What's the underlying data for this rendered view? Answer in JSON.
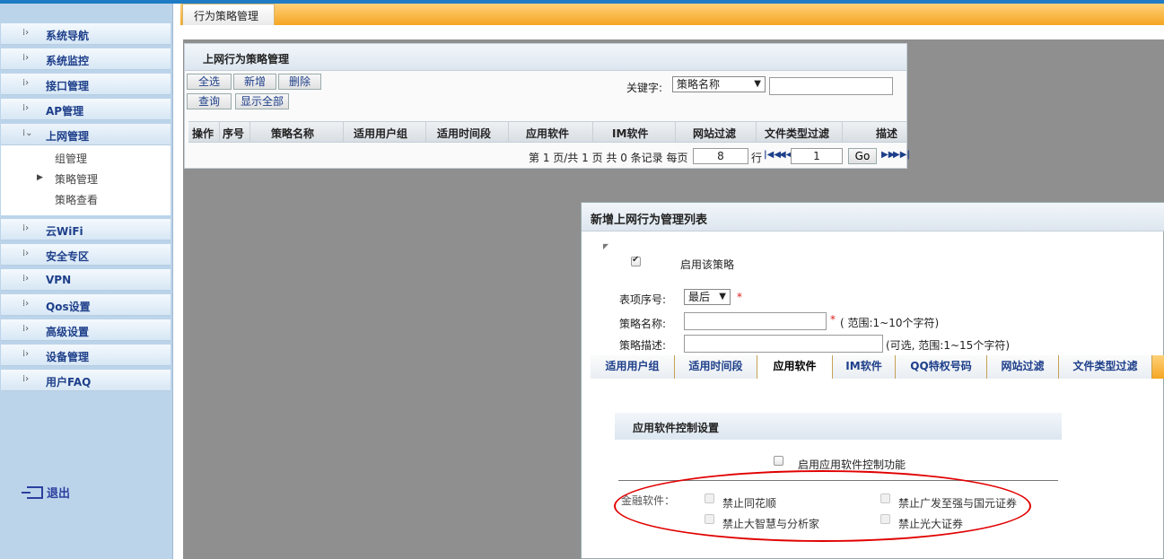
{
  "sidebar": {
    "items": [
      {
        "label": "系统导航"
      },
      {
        "label": "系统监控"
      },
      {
        "label": "接口管理"
      },
      {
        "label": "AP管理"
      },
      {
        "label": "上网管理"
      },
      {
        "label": "云WiFi"
      },
      {
        "label": "安全专区"
      },
      {
        "label": "VPN"
      },
      {
        "label": "Qos设置"
      },
      {
        "label": "高级设置"
      },
      {
        "label": "设备管理"
      },
      {
        "label": "用户FAQ"
      }
    ],
    "sub_items": [
      {
        "label": "组管理"
      },
      {
        "label": "策略管理"
      },
      {
        "label": "策略查看"
      }
    ],
    "logout": "退出"
  },
  "main": {
    "tab": "行为策略管理",
    "panel_title": "上网行为策略管理",
    "buttons": {
      "select_all": "全选",
      "add": "新增",
      "delete": "删除",
      "query": "查询",
      "show_all": "显示全部"
    },
    "keyword_label": "关键字:",
    "keyword_select": "策略名称",
    "columns": [
      "操作",
      "序号",
      "策略名称",
      "适用用户组",
      "适用时间段",
      "应用软件",
      "IM软件",
      "网站过滤",
      "文件类型过滤",
      "描述"
    ],
    "pager": {
      "text": "第 1 页/共 1 页 共 0 条记录 每页",
      "per_page": "8",
      "row_unit": "行",
      "page": "1",
      "go": "Go"
    }
  },
  "dialog": {
    "title": "新增上网行为管理列表",
    "enable_label": "启用该策略",
    "order_label": "表项序号:",
    "order_value": "最后",
    "name_label": "策略名称:",
    "name_hint": "( 范围:1~10个字符)",
    "desc_label": "策略描述:",
    "desc_hint": "(可选, 范围:1~15个字符)",
    "required_mark": "*",
    "tabs": [
      "适用用户组",
      "适用时间段",
      "应用软件",
      "IM软件",
      "QQ特权号码",
      "网站过滤",
      "文件类型过滤"
    ],
    "section_title": "应用软件控制设置",
    "enable_app_control": "启用应用软件控制功能",
    "finance_label": "金融软件：",
    "options": [
      "禁止同花顺",
      "禁止广发至强与国元证券",
      "禁止大智慧与分析家",
      "禁止光大证券"
    ]
  },
  "colors": {
    "accent_orange": "#f5a623",
    "link_blue": "#1e3f8a",
    "annotation_red": "#e10000",
    "top_bar": "#1f7bc4"
  }
}
